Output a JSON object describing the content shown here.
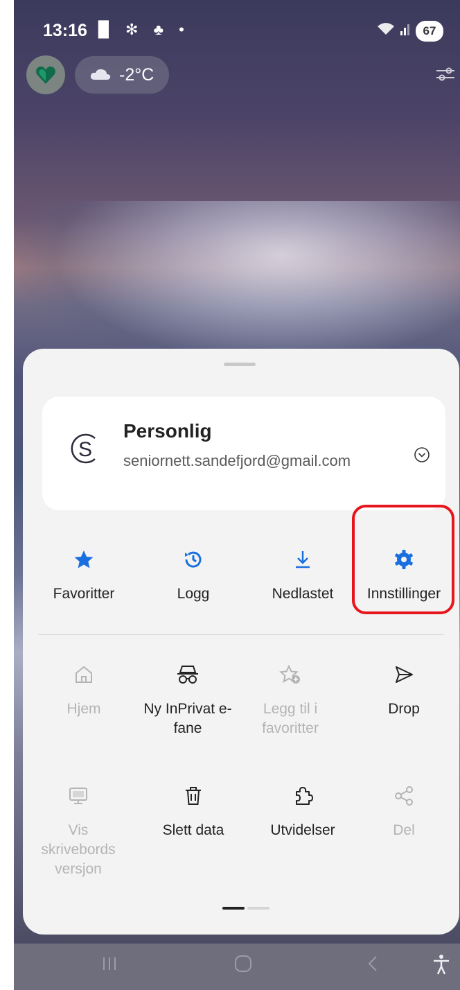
{
  "status": {
    "time": "13:16",
    "icons": "▉ ✻ ♣ •",
    "battery": "67"
  },
  "widgets": {
    "weather_temp": "-2°C"
  },
  "account": {
    "name": "Personlig",
    "email": "seniornett.sandefjord@gmail.com",
    "avatar_letter": "S"
  },
  "quick_actions": [
    {
      "label": "Favoritter",
      "icon": "star-icon"
    },
    {
      "label": "Logg",
      "icon": "history-icon"
    },
    {
      "label": "Nedlastet",
      "icon": "download-icon"
    },
    {
      "label": "Innstillinger",
      "icon": "gear-icon"
    }
  ],
  "grid": {
    "hjem": "Hjem",
    "inprivate": "Ny InPrivat e-fane",
    "add_fav": "Legg til i favoritter",
    "drop": "Drop",
    "desktop": "Vis skrivebords versjon",
    "clear_data": "Slett data",
    "extensions": "Utvidelser",
    "share": "Del"
  },
  "colors": {
    "accent": "#1a6fe0",
    "highlight": "#e8141b",
    "disabled": "#b4b4b4"
  },
  "pager": {
    "pages": 2,
    "current": 1
  }
}
